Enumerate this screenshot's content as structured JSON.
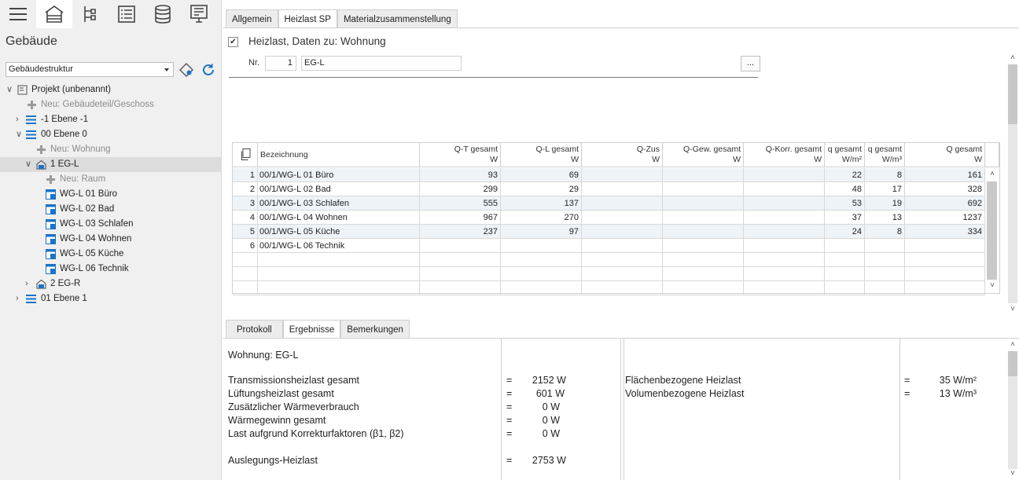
{
  "left_panel": {
    "title": "Gebäude",
    "structure_select": "Gebäudestruktur",
    "toolbar": [
      "menu-icon",
      "building-icon",
      "hierarchy-icon",
      "list-icon",
      "database-icon",
      "monitor-icon"
    ],
    "tree": [
      {
        "label": "Projekt (unbenannt)",
        "icon": "project-icon"
      },
      {
        "label": "Neu: Gebäudeteil/Geschoss",
        "icon": "add-icon"
      },
      {
        "label": "-1 Ebene -1",
        "icon": "level-icon"
      },
      {
        "label": "00 Ebene 0",
        "icon": "level-icon"
      },
      {
        "label": "Neu: Wohnung",
        "icon": "add-icon"
      },
      {
        "label": "1 EG-L",
        "icon": "apartment-icon"
      },
      {
        "label": "Neu: Raum",
        "icon": "add-icon"
      },
      {
        "label": "WG-L 01 Büro",
        "icon": "room-icon"
      },
      {
        "label": "WG-L 02 Bad",
        "icon": "room-icon"
      },
      {
        "label": "WG-L 03 Schlafen",
        "icon": "room-icon"
      },
      {
        "label": "WG-L 04 Wohnen",
        "icon": "room-icon"
      },
      {
        "label": "WG-L 05 Küche",
        "icon": "room-icon"
      },
      {
        "label": "WG-L 06 Technik",
        "icon": "room-icon"
      },
      {
        "label": "2 EG-R",
        "icon": "apartment-icon"
      },
      {
        "label": "01 Ebene 1",
        "icon": "level-icon"
      }
    ]
  },
  "top_tabs": [
    "Allgemein",
    "Heizlast SP",
    "Materialzusammenstellung"
  ],
  "heizlast": {
    "checkbox_label": "Heizlast, Daten zu: Wohnung",
    "nr_label": "Nr.",
    "nr_value": "1",
    "name_value": "EG-L",
    "more_button": "..."
  },
  "table": {
    "header_title": "Bezeichnung",
    "columns": [
      {
        "label": "Q-T gesamt",
        "unit": "W"
      },
      {
        "label": "Q-L gesamt",
        "unit": "W"
      },
      {
        "label": "Q-Zus",
        "unit": "W"
      },
      {
        "label": "Q-Gew. gesamt",
        "unit": "W"
      },
      {
        "label": "Q-Korr. gesamt",
        "unit": "W"
      },
      {
        "label": "q gesamt",
        "unit": "W/m²"
      },
      {
        "label": "q gesamt",
        "unit": "W/m³"
      },
      {
        "label": "Q gesamt",
        "unit": "W"
      }
    ],
    "rows": [
      {
        "no": "1",
        "name": "00/1/WG-L 01 Büro",
        "vals": [
          "93",
          "69",
          "",
          "",
          "",
          "22",
          "8",
          "161"
        ]
      },
      {
        "no": "2",
        "name": "00/1/WG-L 02 Bad",
        "vals": [
          "299",
          "29",
          "",
          "",
          "",
          "48",
          "17",
          "328"
        ]
      },
      {
        "no": "3",
        "name": "00/1/WG-L 03 Schlafen",
        "vals": [
          "555",
          "137",
          "",
          "",
          "",
          "53",
          "19",
          "692"
        ]
      },
      {
        "no": "4",
        "name": "00/1/WG-L 04 Wohnen",
        "vals": [
          "967",
          "270",
          "",
          "",
          "",
          "37",
          "13",
          "1237"
        ]
      },
      {
        "no": "5",
        "name": "00/1/WG-L 05 Küche",
        "vals": [
          "237",
          "97",
          "",
          "",
          "",
          "24",
          "8",
          "334"
        ]
      },
      {
        "no": "6",
        "name": "00/1/WG-L 06 Technik",
        "vals": [
          "",
          "",
          "",
          "",
          "",
          "",
          "",
          ""
        ]
      }
    ]
  },
  "bottom_tabs": [
    "Protokoll",
    "Ergebnisse",
    "Bemerkungen"
  ],
  "results": {
    "title": "Wohnung: EG-L",
    "left": [
      {
        "label": "Transmissionsheizlast gesamt",
        "eq": "=",
        "value": "2152 W"
      },
      {
        "label": "Lüftungsheizlast gesamt",
        "eq": "=",
        "value": "601 W"
      },
      {
        "label": "Zusätzlicher Wärmeverbrauch",
        "eq": "=",
        "value": "0 W"
      },
      {
        "label": "Wärmegewinn gesamt",
        "eq": "=",
        "value": "0 W"
      },
      {
        "label": "Last aufgrund Korrekturfaktoren (β1, β2)",
        "eq": "=",
        "value": "0 W"
      }
    ],
    "total": {
      "label": "Auslegungs-Heizlast",
      "eq": "=",
      "value": "2753 W"
    },
    "right": [
      {
        "label": "Flächenbezogene Heizlast",
        "eq": "=",
        "value": "35 W/m²"
      },
      {
        "label": "Volumenbezogene Heizlast",
        "eq": "=",
        "value": "13 W/m³"
      }
    ]
  },
  "colors": {
    "accent_blue": "#1a73c9",
    "add_gray": "#9a9a9a",
    "selected_row": "#dcdcdc",
    "alt_row": "#eef3f8"
  }
}
